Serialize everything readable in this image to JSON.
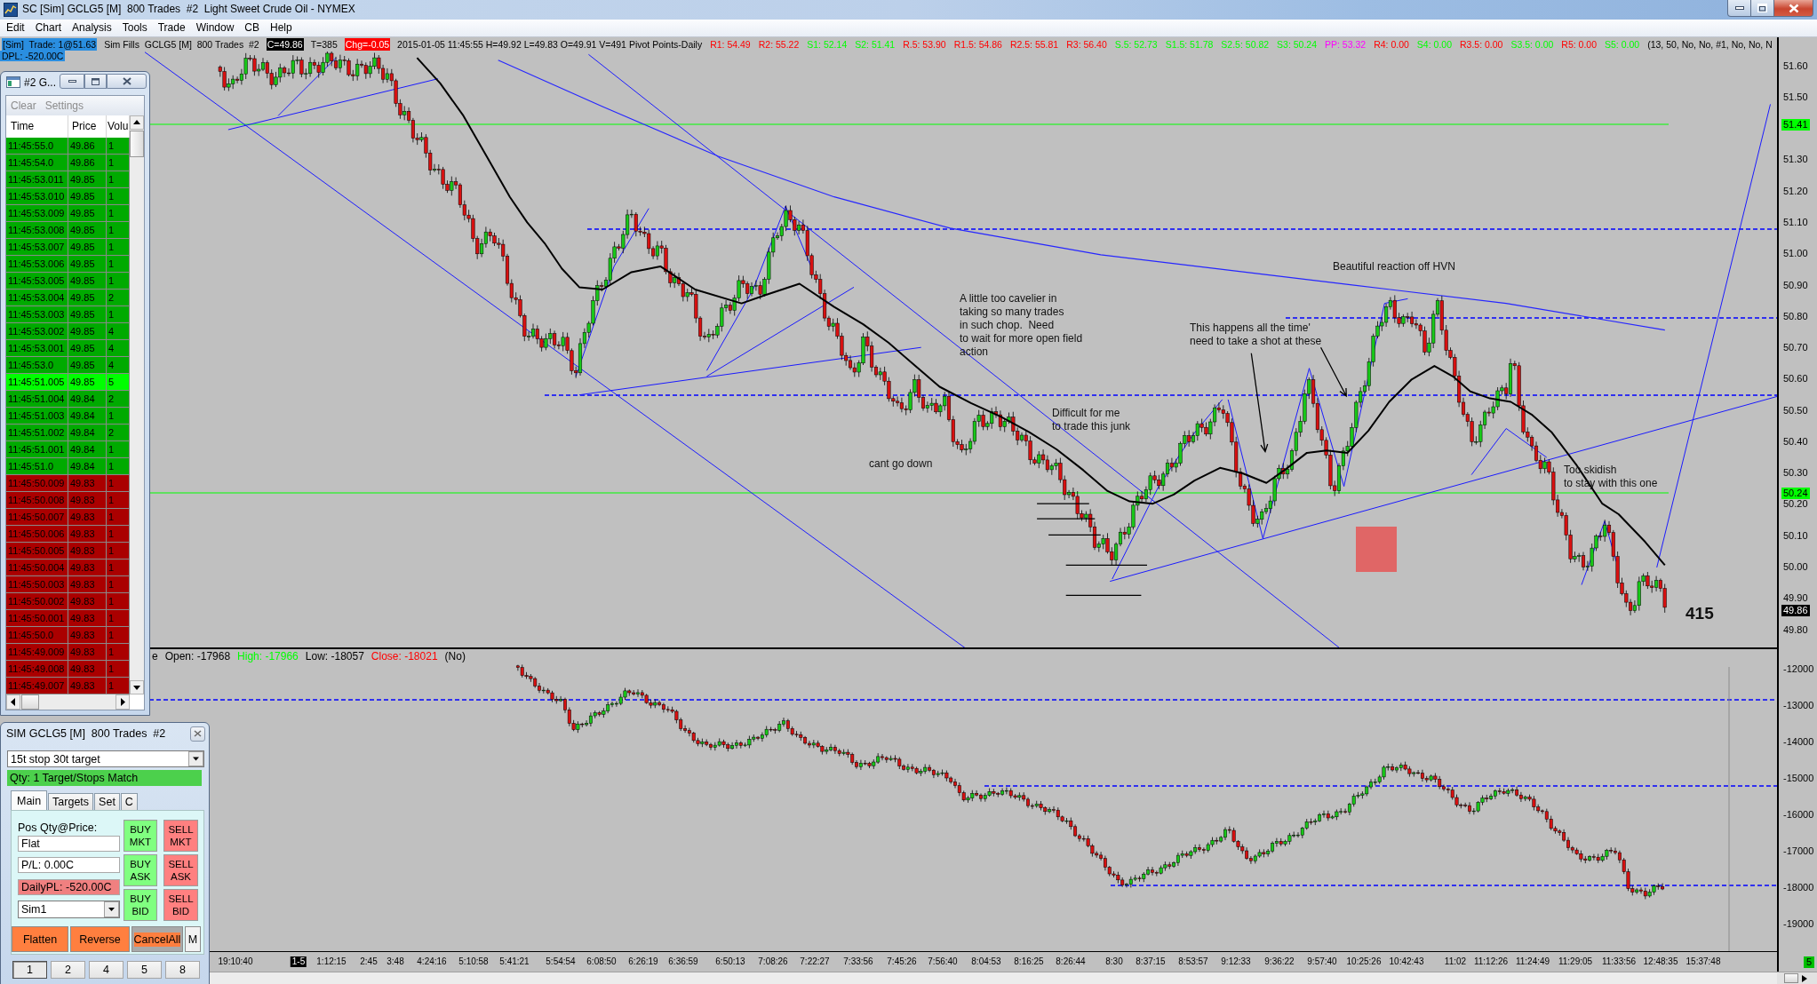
{
  "window": {
    "title": "SC [Sim] GCLG5 [M]  800 Trades  #2  Light Sweet Crude Oil - NYMEX"
  },
  "menu": [
    "Edit",
    "Chart",
    "Analysis",
    "Tools",
    "Trade",
    "Window",
    "CB",
    "Help"
  ],
  "chart": {
    "info_bar": [
      {
        "text": "[Sim]  Trade: 1@51.63",
        "kind": "account"
      },
      {
        "text": "Sim Fills  GCLG5 [M]  800 Trades  #2",
        "kind": "plain"
      },
      {
        "text": "C=49.86",
        "kind": "last"
      },
      {
        "text": "T=385",
        "kind": "plain"
      },
      {
        "text": "Chg=-0.05",
        "kind": "change"
      },
      {
        "text": "2015-01-05 11:45:55 H=49.92 L=49.83 O=49.91 V=491 Pivot Points-Daily",
        "kind": "plain"
      }
    ],
    "pivots": [
      {
        "text": "R1: 54.49",
        "color": "#ff0000"
      },
      {
        "text": "R2: 55.22",
        "color": "#ff0000"
      },
      {
        "text": "S1: 52.14",
        "color": "#00ff00"
      },
      {
        "text": "S2: 51.41",
        "color": "#00ff00"
      },
      {
        "text": "R.5: 53.90",
        "color": "#ff0000"
      },
      {
        "text": "R1.5: 54.86",
        "color": "#ff0000"
      },
      {
        "text": "R2.5: 55.81",
        "color": "#ff0000"
      },
      {
        "text": "R3: 56.40",
        "color": "#ff0000"
      },
      {
        "text": "S.5: 52.73",
        "color": "#00ff00"
      },
      {
        "text": "S1.5: 51.78",
        "color": "#00ff00"
      },
      {
        "text": "S2.5: 50.82",
        "color": "#00ff00"
      },
      {
        "text": "S3: 50.24",
        "color": "#00ff00"
      },
      {
        "text": "PP: 53.32",
        "color": "#ff00ff"
      },
      {
        "text": "R4: 0.00",
        "color": "#ff0000"
      },
      {
        "text": "S4: 0.00",
        "color": "#00ff00"
      },
      {
        "text": "R3.5: 0.00",
        "color": "#ff0000"
      },
      {
        "text": "S3.5: 0.00",
        "color": "#00ff00"
      },
      {
        "text": "R5: 0.00",
        "color": "#ff0000"
      },
      {
        "text": "S5: 0.00",
        "color": "#00ff00"
      }
    ],
    "study_params": "(13, 50, No, No, #1, No, No, N",
    "daily_pl": "DPL: -520.00C",
    "notes": [
      "Beautiful reaction off HVN",
      "A little too cavelier in\ntaking so many trades\nin such chop.  Need\nto wait for more open field\naction",
      "This happens all the time'\nneed to take a shot at these",
      "Difficult for me\nto trade this junk",
      "cant go down",
      "Too skidish\nto stay with this one"
    ],
    "bar_count": "415",
    "price_axis": {
      "labels": [
        "51.60",
        "51.50",
        "51.30",
        "51.20",
        "51.10",
        "51.00",
        "50.90",
        "50.80",
        "50.70",
        "50.60",
        "50.50",
        "50.40",
        "50.30",
        "50.20",
        "50.10",
        "50.00",
        "49.90",
        "49.80"
      ],
      "markers": [
        {
          "text": "51.41",
          "color": "#00ff00"
        },
        {
          "text": "50.24",
          "color": "#00ff00"
        },
        {
          "text": "49.86",
          "color": "#000000"
        }
      ]
    },
    "lower_panel": {
      "header": [
        {
          "text": "e",
          "color": "#000000"
        },
        {
          "text": "Open: -17968",
          "color": "#000000"
        },
        {
          "text": "High: -17966",
          "color": "#00ff00"
        },
        {
          "text": "Low: -18057",
          "color": "#000000"
        },
        {
          "text": "Close: -18021",
          "color": "#ff0000"
        },
        {
          "text": "(No)",
          "color": "#000000"
        }
      ]
    },
    "lower_axis": [
      "-12000",
      "-13000",
      "-14000",
      "-15000",
      "-16000",
      "-17000",
      "-18000",
      "-19000"
    ],
    "time_axis": {
      "labels": [
        "19:10:40",
        "1:12:15",
        "2:45",
        "3:48",
        "4:24:16",
        "5:10:58",
        "5:41:21",
        "5:54:54",
        "6:08:50",
        "6:26:19",
        "6:36:59",
        "6:50:13",
        "7:08:26",
        "7:22:27",
        "7:33:56",
        "7:45:26",
        "7:56:40",
        "8:04:53",
        "8:16:25",
        "8:26:44",
        "8:30",
        "8:37:15",
        "8:53:57",
        "9:12:33",
        "9:36:22",
        "9:57:40",
        "10:25:26",
        "10:42:43",
        "11:02",
        "11:12:26",
        "11:24:49",
        "11:29:05",
        "11:33:56",
        "12:48:35",
        "15:37:48"
      ],
      "date_label": "1-5"
    },
    "corner_badge": "5"
  },
  "time_sales": {
    "title": "#2 G...",
    "menu": [
      {
        "label": "Clear",
        "disabled": true
      },
      {
        "label": "Settings",
        "disabled": true
      }
    ],
    "columns": [
      "Time",
      "Price",
      "Volu"
    ],
    "rows": [
      {
        "time": "11:45:55.0",
        "price": "49.86",
        "volume": "1",
        "color": "#00aa00"
      },
      {
        "time": "11:45:54.0",
        "price": "49.86",
        "volume": "1",
        "color": "#00aa00"
      },
      {
        "time": "11:45:53.011",
        "price": "49.85",
        "volume": "1",
        "color": "#00aa00"
      },
      {
        "time": "11:45:53.010",
        "price": "49.85",
        "volume": "1",
        "color": "#00aa00"
      },
      {
        "time": "11:45:53.009",
        "price": "49.85",
        "volume": "1",
        "color": "#00aa00"
      },
      {
        "time": "11:45:53.008",
        "price": "49.85",
        "volume": "1",
        "color": "#00aa00"
      },
      {
        "time": "11:45:53.007",
        "price": "49.85",
        "volume": "1",
        "color": "#00aa00"
      },
      {
        "time": "11:45:53.006",
        "price": "49.85",
        "volume": "1",
        "color": "#00aa00"
      },
      {
        "time": "11:45:53.005",
        "price": "49.85",
        "volume": "1",
        "color": "#00aa00"
      },
      {
        "time": "11:45:53.004",
        "price": "49.85",
        "volume": "2",
        "color": "#00aa00"
      },
      {
        "time": "11:45:53.003",
        "price": "49.85",
        "volume": "1",
        "color": "#00aa00"
      },
      {
        "time": "11:45:53.002",
        "price": "49.85",
        "volume": "4",
        "color": "#00aa00"
      },
      {
        "time": "11:45:53.001",
        "price": "49.85",
        "volume": "4",
        "color": "#00aa00"
      },
      {
        "time": "11:45:53.0",
        "price": "49.85",
        "volume": "4",
        "color": "#00aa00"
      },
      {
        "time": "11:45:51.005",
        "price": "49.85",
        "volume": "5",
        "color": "#00ff00"
      },
      {
        "time": "11:45:51.004",
        "price": "49.84",
        "volume": "2",
        "color": "#00aa00"
      },
      {
        "time": "11:45:51.003",
        "price": "49.84",
        "volume": "1",
        "color": "#00aa00"
      },
      {
        "time": "11:45:51.002",
        "price": "49.84",
        "volume": "2",
        "color": "#00aa00"
      },
      {
        "time": "11:45:51.001",
        "price": "49.84",
        "volume": "1",
        "color": "#00aa00"
      },
      {
        "time": "11:45:51.0",
        "price": "49.84",
        "volume": "1",
        "color": "#00aa00"
      },
      {
        "time": "11:45:50.009",
        "price": "49.83",
        "volume": "1",
        "color": "#aa0000"
      },
      {
        "time": "11:45:50.008",
        "price": "49.83",
        "volume": "1",
        "color": "#aa0000"
      },
      {
        "time": "11:45:50.007",
        "price": "49.83",
        "volume": "1",
        "color": "#aa0000"
      },
      {
        "time": "11:45:50.006",
        "price": "49.83",
        "volume": "1",
        "color": "#aa0000"
      },
      {
        "time": "11:45:50.005",
        "price": "49.83",
        "volume": "1",
        "color": "#aa0000"
      },
      {
        "time": "11:45:50.004",
        "price": "49.83",
        "volume": "1",
        "color": "#aa0000"
      },
      {
        "time": "11:45:50.003",
        "price": "49.83",
        "volume": "1",
        "color": "#aa0000"
      },
      {
        "time": "11:45:50.002",
        "price": "49.83",
        "volume": "1",
        "color": "#aa0000"
      },
      {
        "time": "11:45:50.001",
        "price": "49.83",
        "volume": "1",
        "color": "#aa0000"
      },
      {
        "time": "11:45:50.0",
        "price": "49.83",
        "volume": "1",
        "color": "#aa0000"
      },
      {
        "time": "11:45:49.009",
        "price": "49.83",
        "volume": "1",
        "color": "#aa0000"
      },
      {
        "time": "11:45:49.008",
        "price": "49.83",
        "volume": "1",
        "color": "#aa0000"
      },
      {
        "time": "11:45:49.007",
        "price": "49.83",
        "volume": "1",
        "color": "#aa0000"
      }
    ]
  },
  "order_window": {
    "title": "SIM GCLG5 [M]  800 Trades  #2",
    "strategy": "15t stop 30t target",
    "status": "Qty: 1 Target/Stops Match",
    "tabs": [
      {
        "label": "Main",
        "selected": true
      },
      {
        "label": "Targets",
        "selected": false
      },
      {
        "label": "Set",
        "selected": false
      },
      {
        "label": "C",
        "selected": false
      }
    ],
    "position_label": "Pos Qty@Price:",
    "fields": [
      {
        "value": "Flat",
        "kind": "plain"
      },
      {
        "value": "P/L: 0.00C",
        "kind": "plain"
      },
      {
        "value": "DailyPL: -520.00C",
        "kind": "loss"
      }
    ],
    "account": "Sim1",
    "trade_buttons": [
      {
        "label": "BUY MKT",
        "kind": "buy"
      },
      {
        "label": "SELL MKT",
        "kind": "sell"
      },
      {
        "label": "BUY ASK",
        "kind": "buy"
      },
      {
        "label": "SELL ASK",
        "kind": "sell"
      },
      {
        "label": "BUY BID",
        "kind": "buy"
      },
      {
        "label": "SELL BID",
        "kind": "sell"
      }
    ],
    "actions": [
      {
        "label": "Flatten",
        "kind": "action"
      },
      {
        "label": "Reverse",
        "kind": "action"
      },
      {
        "label": "CancelAll",
        "kind": "cancel"
      },
      {
        "label": "M",
        "kind": "plain"
      }
    ],
    "quantities": [
      {
        "label": "1",
        "selected": true
      },
      {
        "label": "2",
        "selected": false
      },
      {
        "label": "4",
        "selected": false
      },
      {
        "label": "5",
        "selected": false
      },
      {
        "label": "8",
        "selected": false
      }
    ]
  }
}
